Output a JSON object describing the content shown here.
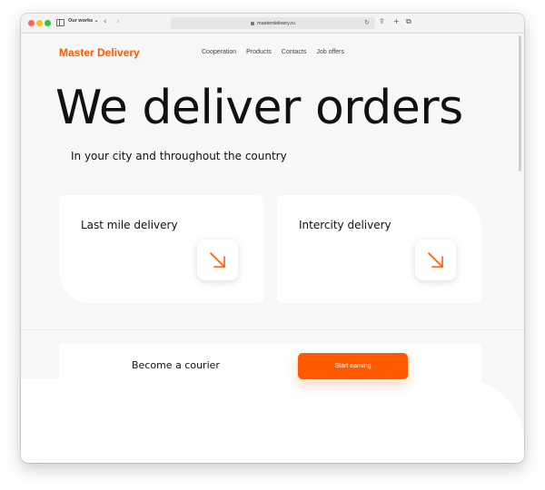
{
  "browser": {
    "tab_group_label": "Our works ⌄",
    "url": "masterdelivery.ru"
  },
  "site": {
    "logo": "Master Delivery",
    "nav": [
      "Cooperation",
      "Products",
      "Contacts",
      "Job offers"
    ]
  },
  "hero": {
    "title": "We deliver orders",
    "subtitle": "In your city and throughout the country"
  },
  "cards": [
    {
      "title": "Last mile delivery"
    },
    {
      "title": "Intercity delivery"
    }
  ],
  "courier": {
    "label": "Become a courier",
    "button": "Start earning"
  },
  "colors": {
    "accent": "#ff5a00",
    "page_bg": "#f7f7f7",
    "card_bg": "#ffffff",
    "text": "#111111"
  },
  "icons": [
    "sidebar-icon",
    "back-arrow-icon",
    "forward-arrow-icon",
    "lock-icon",
    "reload-icon",
    "share-icon",
    "new-tab-icon",
    "tab-overview-icon",
    "arrow-down-right-icon"
  ]
}
